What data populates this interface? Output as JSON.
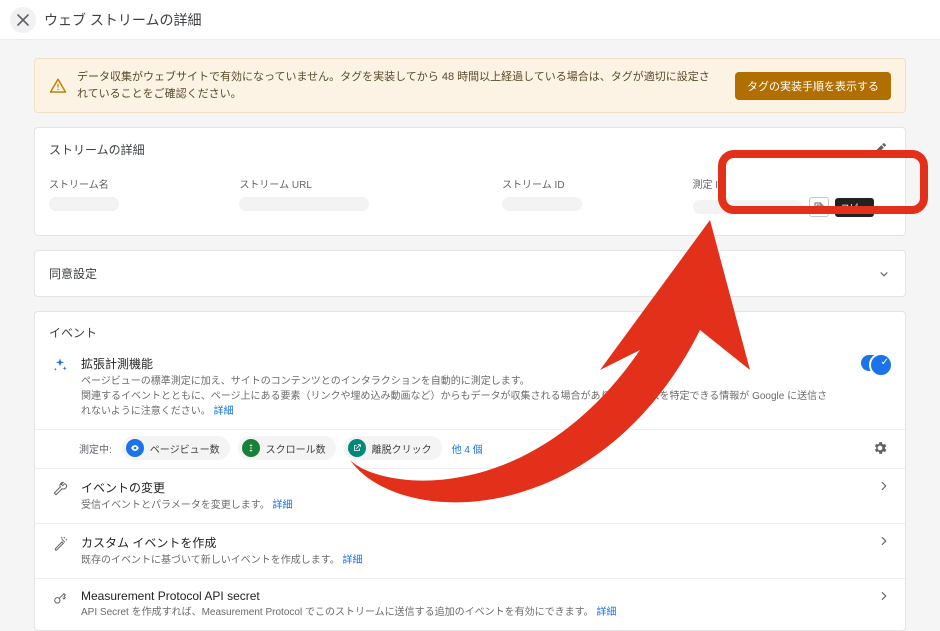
{
  "header": {
    "title": "ウェブ ストリームの詳細"
  },
  "alert": {
    "text": "データ収集がウェブサイトで有効になっていません。タグを実装してから 48 時間以上経過している場合は、タグが適切に設定されていることをご確認ください。",
    "button": "タグの実装手順を表示する"
  },
  "streamDetails": {
    "title": "ストリームの詳細",
    "fields": {
      "name": "ストリーム名",
      "url": "ストリーム URL",
      "id": "ストリーム ID",
      "measurement": "測定 ID"
    },
    "copy_tooltip": "コピー"
  },
  "consent": {
    "title": "同意設定"
  },
  "events": {
    "title": "イベント",
    "enhanced": {
      "title": "拡張計測機能",
      "desc_a": "ページビューの標準測定に加え、サイトのコンテンツとのインタラクションを自動的に測定します。",
      "desc_b_prefix": "関連するイベントとともに、ページ上にある要素（リンクや埋め込み動画など）からもデータが収集される場合があります。個人を特定できる情報が Google に送信されないように注意ください。",
      "desc_link": "詳細",
      "measuring_label": "測定中:",
      "pill1": "ページビュー数",
      "pill2": "スクロール数",
      "pill3": "離脱クリック",
      "plus": "他 4 個"
    },
    "modify": {
      "title": "イベントの変更",
      "desc": "受信イベントとパラメータを変更します。",
      "link": "詳細"
    },
    "custom": {
      "title": "カスタム イベントを作成",
      "desc": "既存のイベントに基づいて新しいイベントを作成します。",
      "link": "詳細"
    },
    "mp": {
      "title": "Measurement Protocol API secret",
      "desc": "API Secret を作成すれば、Measurement Protocol でこのストリームに送信する追加のイベントを有効にできます。",
      "link": "詳細"
    }
  }
}
